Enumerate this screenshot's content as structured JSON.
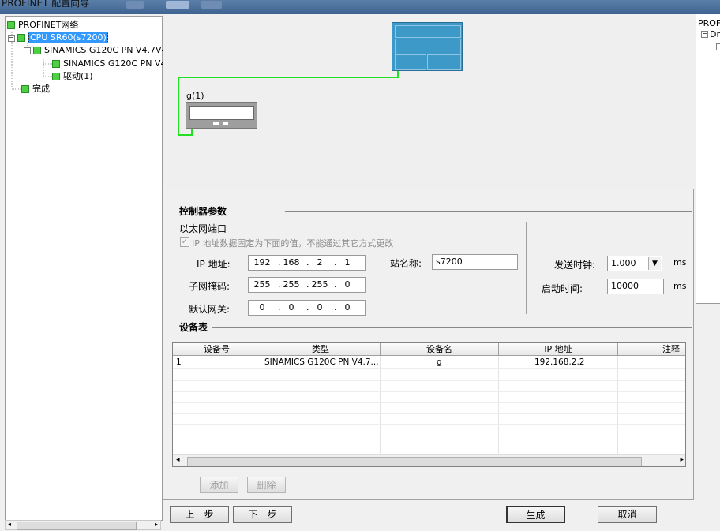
{
  "window": {
    "title": "PROFINET 配置向导"
  },
  "tree": {
    "items": [
      {
        "label": "PROFINET网络"
      },
      {
        "label": "CPU SR60(s7200)"
      },
      {
        "label": "SINAMICS G120C PN V4.7V4"
      },
      {
        "label": "SINAMICS G120C PN V4."
      },
      {
        "label": "驱动(1)"
      },
      {
        "label": "完成"
      }
    ]
  },
  "right_tree": {
    "root": "PROF",
    "child": "Dr"
  },
  "canvas": {
    "device_label": "g(1)"
  },
  "params": {
    "section_title": "控制器参数",
    "ethernet_label": "以太网端口",
    "fixed_ip_checkbox_label": "IP 地址数据固定为下面的值，不能通过其它方式更改",
    "fixed_ip_checked": true,
    "ip_label": "IP 地址:",
    "ip": [
      "192",
      "168",
      "2",
      "1"
    ],
    "subnet_label": "子网掩码:",
    "subnet": [
      "255",
      "255",
      "255",
      "0"
    ],
    "gateway_label": "默认网关:",
    "gateway": [
      "0",
      "0",
      "0",
      "0"
    ],
    "station_label": "站名称:",
    "station_value": "s7200",
    "send_clock_label": "发送时钟:",
    "send_clock_value": "1.000",
    "send_clock_unit": "ms",
    "startup_label": "启动时间:",
    "startup_value": "10000",
    "startup_unit": "ms"
  },
  "device_table": {
    "title": "设备表",
    "columns": [
      "设备号",
      "类型",
      "设备名",
      "IP 地址",
      "注释"
    ],
    "rows": [
      [
        "1",
        "SINAMICS G120C PN V4.7...",
        "g",
        "192.168.2.2",
        ""
      ]
    ]
  },
  "buttons": {
    "add": "添加",
    "delete": "删除",
    "prev": "上一步",
    "next": "下一步",
    "generate": "生成",
    "cancel": "取消"
  },
  "colors": {
    "link_green": "#22e022",
    "plc_blue": "#3d9ac8",
    "selection": "#3399ff"
  }
}
